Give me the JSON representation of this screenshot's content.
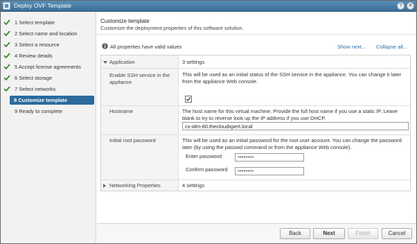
{
  "window": {
    "title": "Deploy OVF Template",
    "help_glyph": "?",
    "close_glyph": "✕"
  },
  "steps": [
    {
      "label": "1  Select template",
      "done": true
    },
    {
      "label": "2  Select name and location",
      "done": true
    },
    {
      "label": "3  Select a resource",
      "done": true
    },
    {
      "label": "4  Review details",
      "done": true
    },
    {
      "label": "5  Accept license agreements",
      "done": true
    },
    {
      "label": "6  Select storage",
      "done": true
    },
    {
      "label": "7  Select networks",
      "done": true
    },
    {
      "label": "8  Customize template",
      "done": false,
      "active": true
    },
    {
      "label": "9  Ready to complete",
      "done": false
    }
  ],
  "content": {
    "title": "Customize template",
    "subtitle": "Customize the deployment properties of this software solution.",
    "validation": "All properties have valid values",
    "show_next": "Show next...",
    "collapse_all": "Collapse all..."
  },
  "properties": {
    "application": {
      "label": "Application",
      "count": "3 settings"
    },
    "ssh": {
      "label": "Enable SSH service in the appliance",
      "description": "This will be used as an initial status of the SSH service in the appliance. You can change it later from the appliance Web console.",
      "checked": true
    },
    "hostname": {
      "label": "Hostname",
      "description": "The host name for this virtual machine. Provide the full host name if you use a static IP. Leave blank to try to reverse look up the IP address if you use DHCP.",
      "value": "cx-idm-60.thecloudxpert.local"
    },
    "root_password": {
      "label": "Initial root password",
      "description": "This will be used as an initial password for the root user account. You can change the password later (by using the passwd command or from the appliance Web console).",
      "enter_label": "Enter password",
      "enter_value": "********",
      "confirm_label": "Confirm password",
      "confirm_value": "********"
    },
    "networking": {
      "label": "Networking Properties",
      "count": "4 settings"
    }
  },
  "buttons": {
    "back": "Back",
    "next": "Next",
    "finish": "Finish",
    "cancel": "Cancel"
  },
  "colors": {
    "accent": "#2b6b9d",
    "link": "#2b6ba8",
    "check": "#3a8a2c"
  }
}
